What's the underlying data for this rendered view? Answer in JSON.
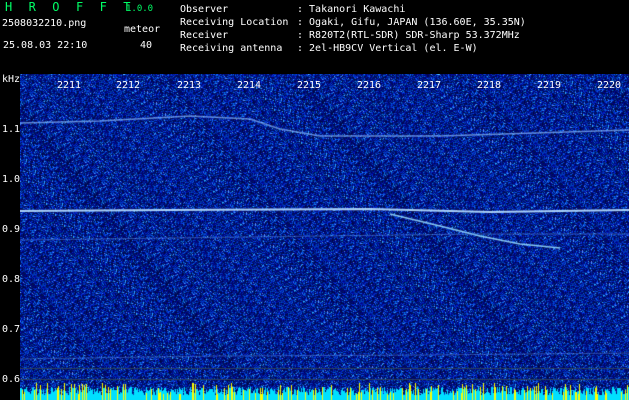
{
  "app": {
    "title": "H R O F F T",
    "version": "1.0.0"
  },
  "file_name": "2508032210.png",
  "datetime": "25.08.03 22:10",
  "meteor": {
    "label": "meteor",
    "count": "40"
  },
  "info": [
    {
      "key": "Observer",
      "value": ": Takanori Kawachi"
    },
    {
      "key": "Receiving Location",
      "value": ": Ogaki, Gifu, JAPAN (136.60E, 35.35N)"
    },
    {
      "key": "Receiver",
      "value": ": R820T2(RTL-SDR) SDR-Sharp 53.372MHz"
    },
    {
      "key": "Receiving antenna",
      "value": ": 2el-HB9CV Vertical (el. E-W)"
    }
  ],
  "axis": {
    "y_unit": "kHz",
    "x_ticks": [
      "2211",
      "2212",
      "2213",
      "2214",
      "2215",
      "2216",
      "2217",
      "2218",
      "2219",
      "2220"
    ],
    "y_ticks": [
      "1.1",
      "1.0",
      "0.9",
      "0.8",
      "0.7",
      "0.6"
    ]
  },
  "colors": {
    "background": "#000000",
    "noise": "#0a1a9a",
    "signal": "#7ec8ff",
    "baseline": "#00e0ff",
    "peak": "#ffff00",
    "text": "#ffffff",
    "title": "#00ff66"
  }
}
